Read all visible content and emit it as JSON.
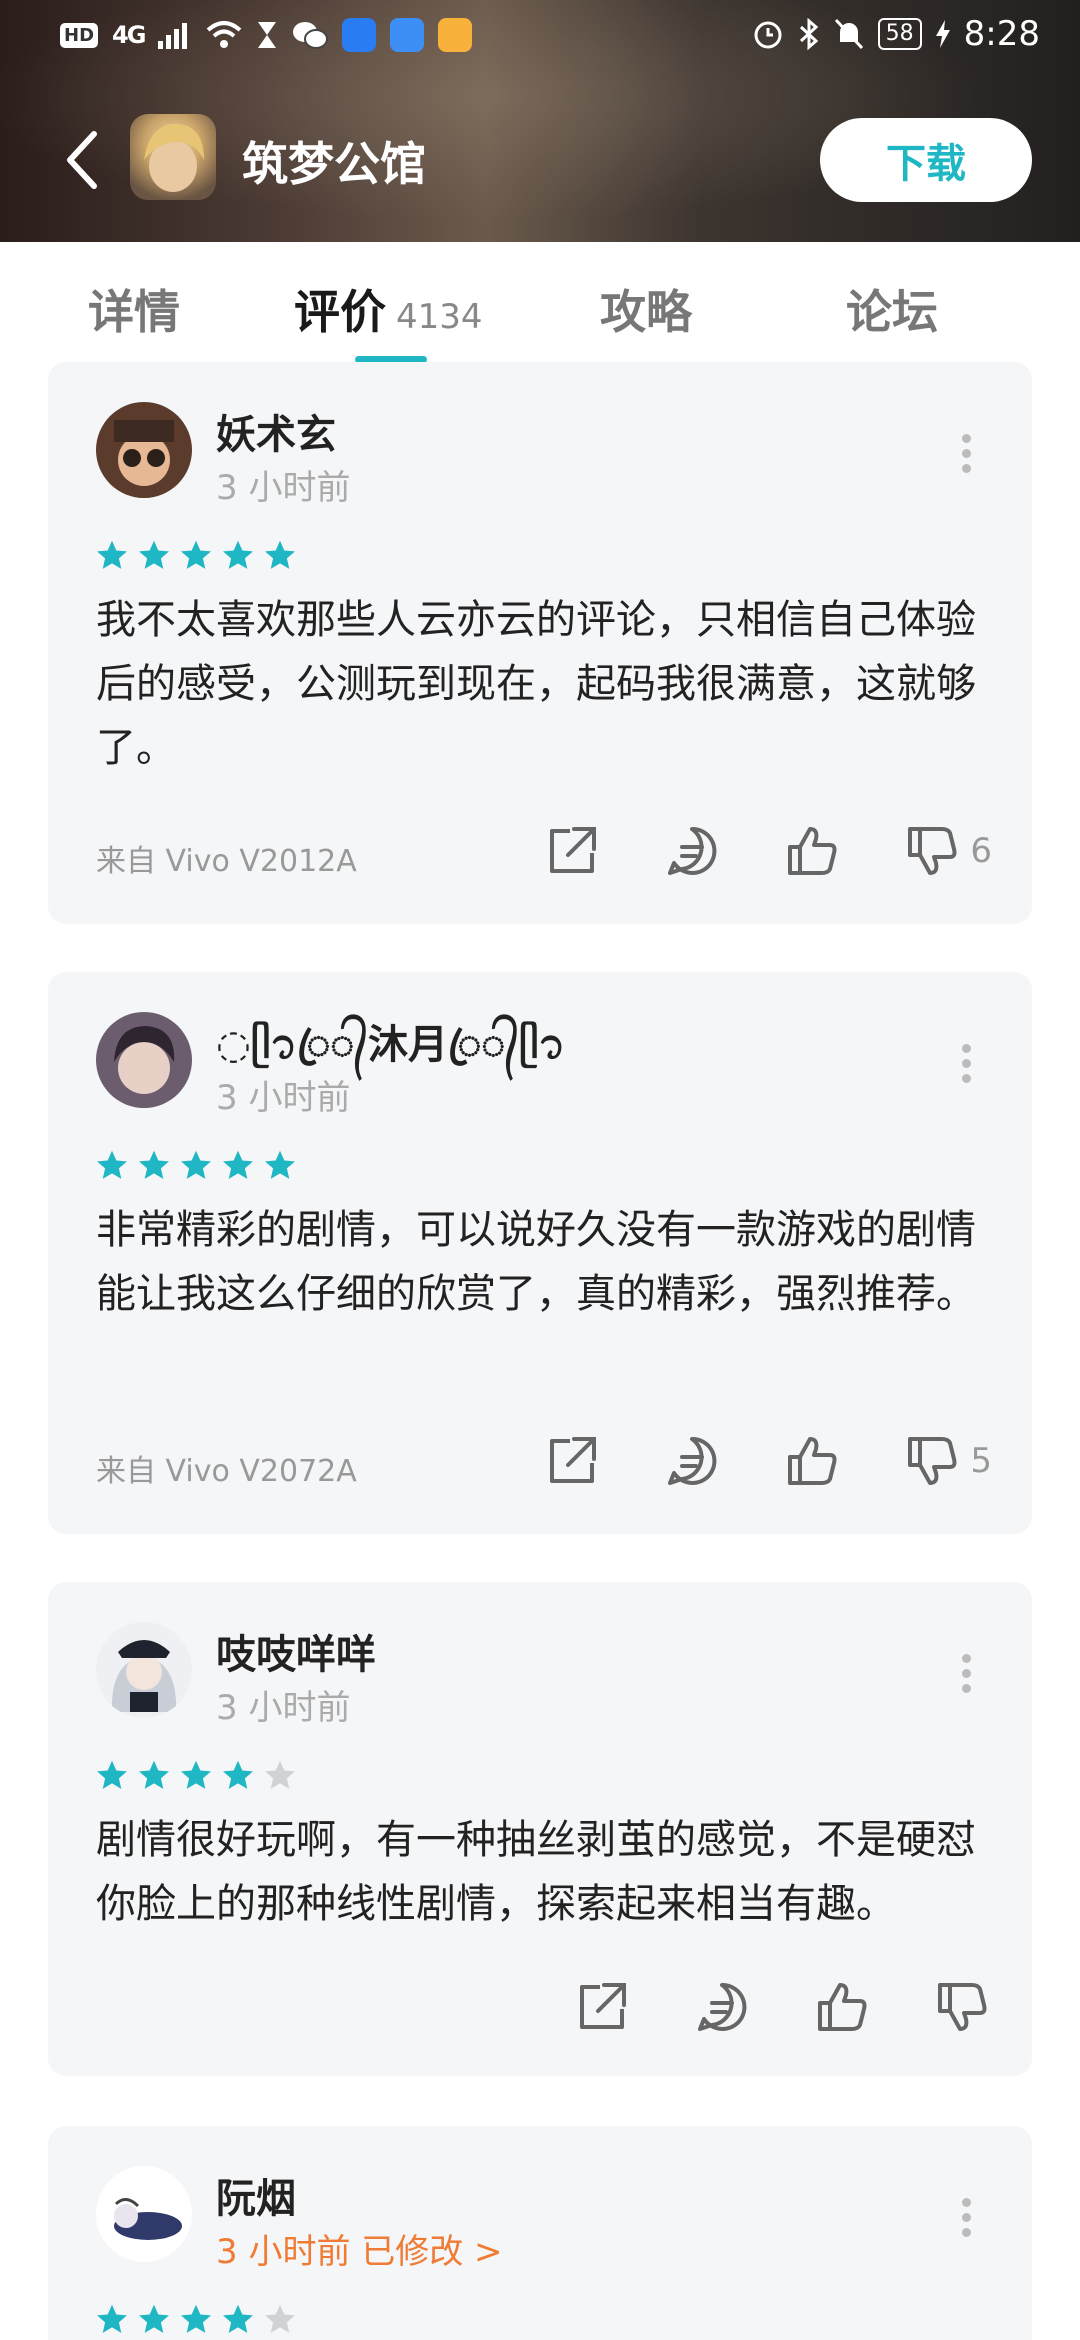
{
  "status_bar": {
    "hd": "HD",
    "network": "4G",
    "battery": "58",
    "time": "8:28"
  },
  "app": {
    "name": "筑梦公馆",
    "download_label": "下载"
  },
  "tabs": [
    {
      "label": "详情",
      "active": false
    },
    {
      "label": "评价",
      "count": "4134",
      "active": true
    },
    {
      "label": "攻略",
      "active": false
    },
    {
      "label": "论坛",
      "active": false
    }
  ],
  "colors": {
    "accent": "#1fb7c4",
    "star_off": "#d0d3d6",
    "edited": "#f07b35"
  },
  "reviews": [
    {
      "user": "妖术玄",
      "time": "3 小时前",
      "rating": 5,
      "text": "我不太喜欢那些人云亦云的评论，只相信自己体验后的感受，公测玩到现在，起码我很满意，这就够了。",
      "device": "来自 Vivo V2012A",
      "dislikes": "6"
    },
    {
      "user": "◌ᥫ᭡ꦿ᭄沐月ꦿ᭄ᥫ᭡",
      "time": "3 小时前",
      "rating": 5,
      "text": "非常精彩的剧情，可以说好久没有一款游戏的剧情能让我这么仔细的欣赏了，真的精彩，强烈推荐。",
      "device": "来自 Vivo V2072A",
      "dislikes": "5"
    },
    {
      "user": "吱吱咩咩",
      "time": "3 小时前",
      "rating": 4,
      "text": "剧情很好玩啊，有一种抽丝剥茧的感觉，不是硬怼你脸上的那种线性剧情，探索起来相当有趣。",
      "device": "",
      "dislikes": ""
    },
    {
      "user": "阮烟",
      "time": "3 小时前 已修改 >",
      "rating": 4,
      "text": "",
      "device": "",
      "dislikes": ""
    }
  ]
}
